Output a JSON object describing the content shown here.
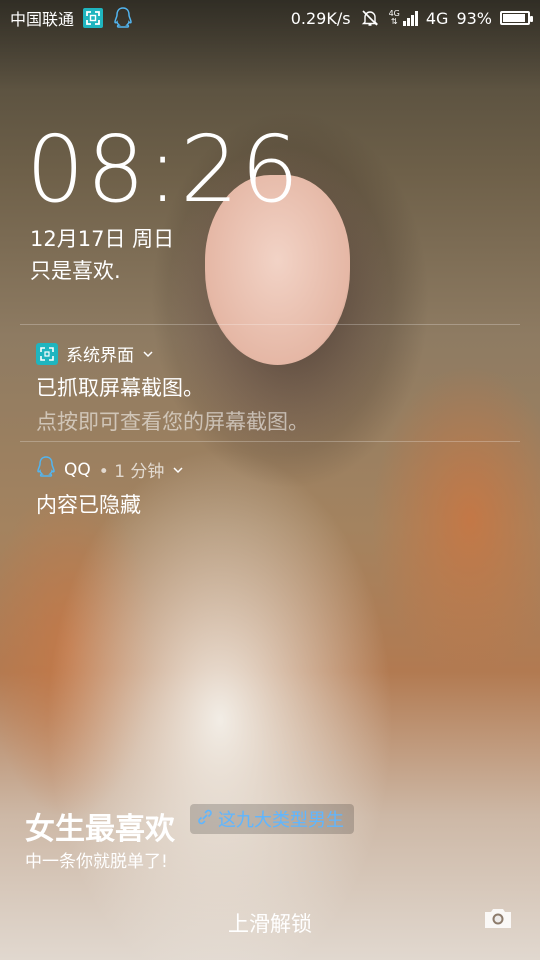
{
  "statusbar": {
    "carrier": "中国联通",
    "speed": "0.29K/s",
    "network_type_small": "4G",
    "network": "4G",
    "battery_percent": "93%",
    "battery_level": 0.93
  },
  "lockscreen": {
    "time": "08:26",
    "date": "12月17日 周日",
    "signature": "只是喜欢."
  },
  "notifications": [
    {
      "app": "系统界面",
      "icon": "screenshot-icon",
      "title": "已抓取屏幕截图。",
      "subtitle": "点按即可查看您的屏幕截图。"
    },
    {
      "app": "QQ",
      "icon": "qq-icon",
      "time": "• 1 分钟",
      "title": "内容已隐藏"
    }
  ],
  "promo": {
    "title": "女生最喜欢",
    "link_text": "这九大类型男生",
    "subtitle": "中一条你就脱单了!"
  },
  "bottom": {
    "unlock_hint": "上滑解锁"
  },
  "colors": {
    "screenshot_icon": "#1fb5bf",
    "link": "#5fb6ff"
  }
}
